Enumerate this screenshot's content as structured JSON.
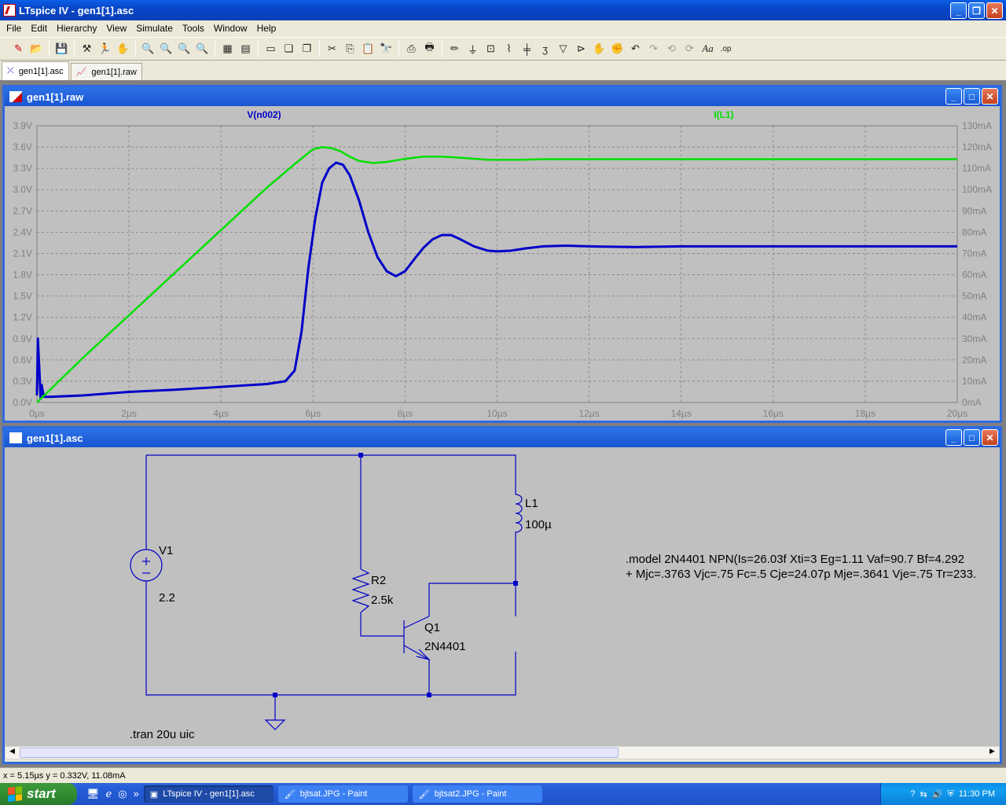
{
  "window": {
    "title": "LTspice IV - gen1[1].asc"
  },
  "menu": [
    "File",
    "Edit",
    "Hierarchy",
    "View",
    "Simulate",
    "Tools",
    "Window",
    "Help"
  ],
  "doc_tabs": [
    {
      "label": "gen1[1].asc",
      "active": true
    },
    {
      "label": "gen1[1].raw",
      "active": false
    }
  ],
  "waveform_window": {
    "title": "gen1[1].raw",
    "trace_labels": {
      "left": "V(n002)",
      "right": "I(L1)"
    },
    "colors": {
      "v": "#0000c8",
      "i": "#00e000",
      "bg": "#c0c0c0",
      "grid": "#808080"
    }
  },
  "schematic_window": {
    "title": "gen1[1].asc",
    "labels": {
      "v1_name": "V1",
      "v1_value": "2.2",
      "r2_name": "R2",
      "r2_value": "2.5k",
      "q1_name": "Q1",
      "q1_value": "2N4401",
      "l1_name": "L1",
      "l1_value": "100µ",
      "directive": ".tran 20u uic",
      "model_line1": ".model 2N4401   NPN(Is=26.03f Xti=3 Eg=1.11 Vaf=90.7 Bf=4.292",
      "model_line2": "+ Mjc=.3763 Vjc=.75 Fc=.5 Cje=24.07p Mje=.3641 Vje=.75 Tr=233."
    }
  },
  "status": {
    "text": "x = 5.15µs    y = 0.332V, 11.08mA"
  },
  "taskbar": {
    "start": "start",
    "tasks": [
      {
        "label": "LTspice IV - gen1[1].asc",
        "active": true
      },
      {
        "label": "bjtsat.JPG - Paint",
        "active": false
      },
      {
        "label": "bjtsat2.JPG - Paint",
        "active": false
      }
    ],
    "clock": "11:30 PM"
  },
  "chart_data": {
    "type": "line",
    "x_label": "",
    "x_ticks": [
      "0µs",
      "2µs",
      "4µs",
      "6µs",
      "8µs",
      "10µs",
      "12µs",
      "14µs",
      "16µs",
      "18µs",
      "20µs"
    ],
    "xlim": [
      0,
      20
    ],
    "y_left_ticks": [
      "0.0V",
      "0.3V",
      "0.6V",
      "0.9V",
      "1.2V",
      "1.5V",
      "1.8V",
      "2.1V",
      "2.4V",
      "2.7V",
      "3.0V",
      "3.3V",
      "3.6V",
      "3.9V"
    ],
    "y_left_lim": [
      0,
      3.9
    ],
    "y_right_ticks": [
      "0mA",
      "10mA",
      "20mA",
      "30mA",
      "40mA",
      "50mA",
      "60mA",
      "70mA",
      "80mA",
      "90mA",
      "100mA",
      "110mA",
      "120mA",
      "130mA"
    ],
    "y_right_lim": [
      0,
      130
    ],
    "series": [
      {
        "name": "V(n002)",
        "axis": "left",
        "x": [
          0,
          0.02,
          0.05,
          0.08,
          0.1,
          0.15,
          0.3,
          1,
          2,
          3,
          4,
          5,
          5.4,
          5.6,
          5.75,
          5.9,
          6.05,
          6.2,
          6.35,
          6.5,
          6.65,
          6.8,
          7.0,
          7.2,
          7.4,
          7.6,
          7.8,
          8.0,
          8.2,
          8.4,
          8.6,
          8.8,
          9.0,
          9.2,
          9.5,
          9.8,
          10.0,
          10.3,
          10.6,
          11.0,
          11.5,
          12,
          13,
          14,
          16,
          18,
          20
        ],
        "y": [
          0.1,
          0.9,
          0.5,
          0.05,
          0.25,
          0.08,
          0.08,
          0.1,
          0.15,
          0.18,
          0.22,
          0.26,
          0.3,
          0.45,
          1.0,
          1.9,
          2.6,
          3.1,
          3.3,
          3.38,
          3.35,
          3.2,
          2.85,
          2.4,
          2.05,
          1.85,
          1.78,
          1.85,
          2.02,
          2.18,
          2.3,
          2.36,
          2.36,
          2.3,
          2.2,
          2.14,
          2.13,
          2.14,
          2.17,
          2.2,
          2.21,
          2.2,
          2.19,
          2.2,
          2.2,
          2.2,
          2.2
        ]
      },
      {
        "name": "I(L1)",
        "axis": "right",
        "x": [
          0,
          1,
          2,
          3,
          4,
          5,
          5.6,
          6.0,
          6.2,
          6.4,
          6.6,
          6.8,
          7.0,
          7.3,
          7.6,
          8.0,
          8.4,
          8.8,
          9.2,
          9.8,
          10.5,
          11,
          12,
          14,
          16,
          18,
          20
        ],
        "y": [
          0,
          21,
          41,
          61,
          81,
          101,
          112,
          119,
          120,
          119.5,
          118,
          115.5,
          113.5,
          112.5,
          113,
          114.5,
          115.5,
          115.5,
          115,
          114,
          114,
          114.3,
          114.3,
          114.3,
          114.3,
          114.3,
          114.3
        ]
      }
    ]
  }
}
